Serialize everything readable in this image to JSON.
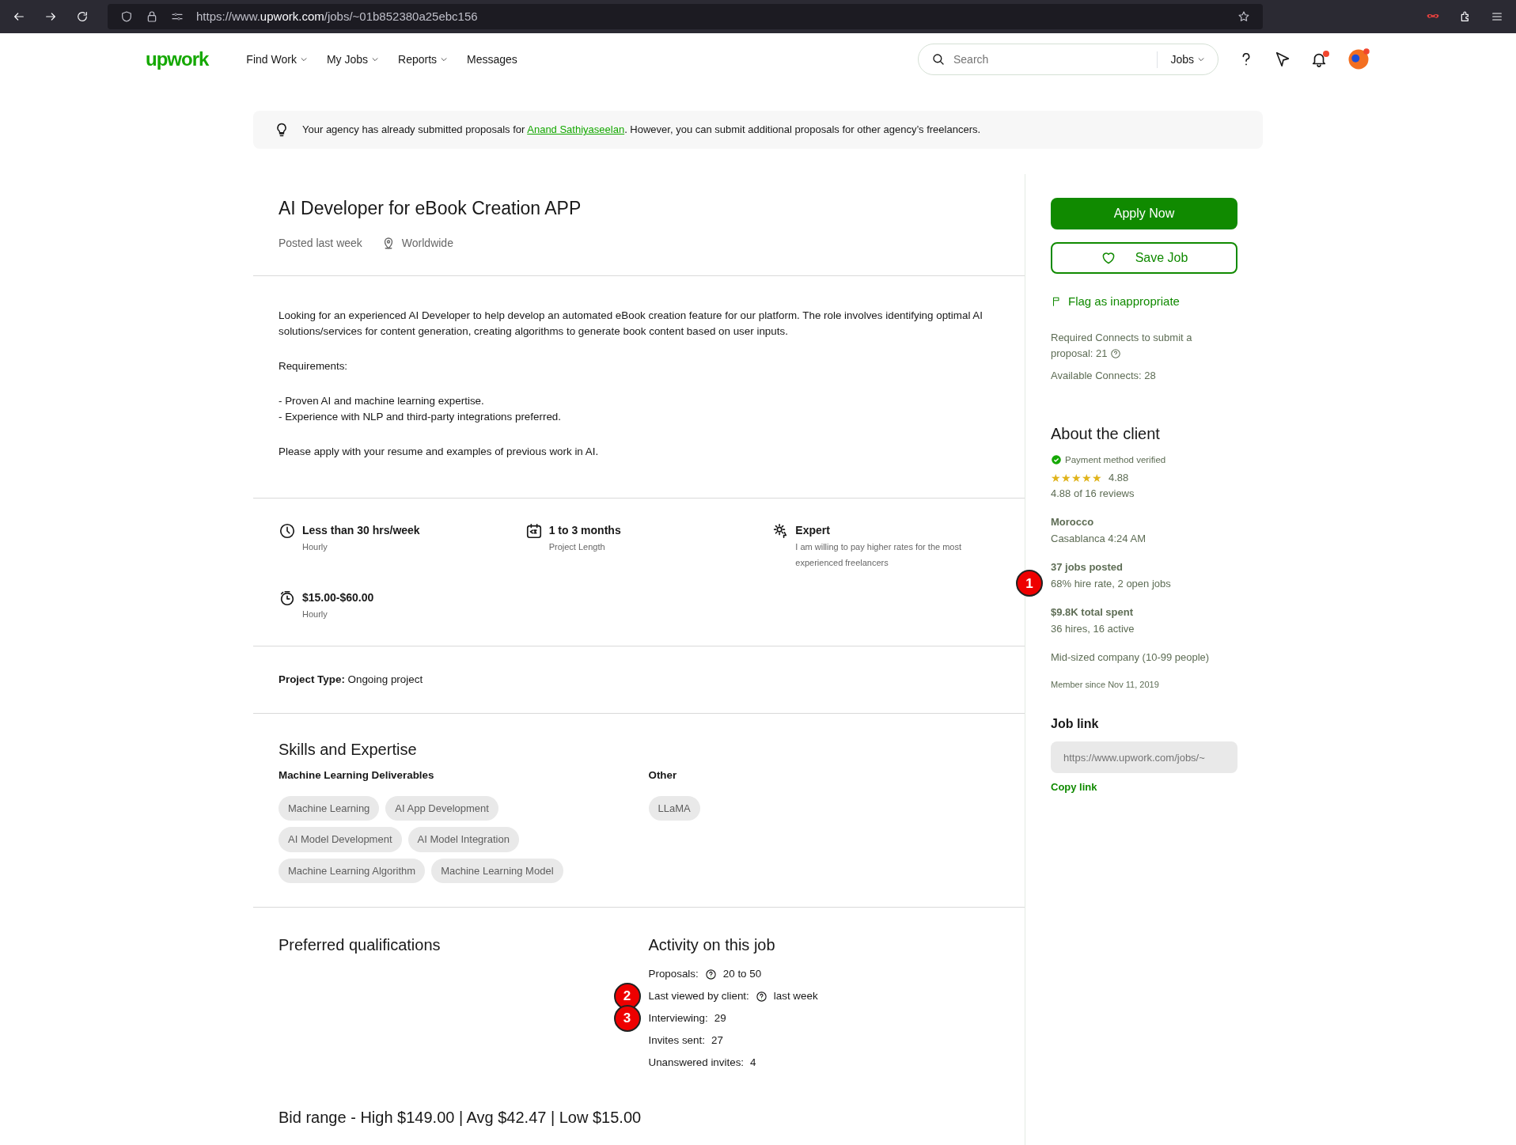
{
  "browser": {
    "url_prefix": "https://www.",
    "url_domain": "upwork.com",
    "url_path": "/jobs/~01b852380a25ebc156"
  },
  "nav": {
    "logo": "upwork",
    "menu": [
      {
        "label": "Find Work",
        "dropdown": true
      },
      {
        "label": "My Jobs",
        "dropdown": true
      },
      {
        "label": "Reports",
        "dropdown": true
      },
      {
        "label": "Messages",
        "dropdown": false
      }
    ],
    "search": {
      "placeholder": "Search",
      "scope": "Jobs"
    },
    "notification_dot": true
  },
  "notice": {
    "before": "Your agency has already submitted proposals for ",
    "link": "Anand Sathiyaseelan",
    "after": ". However, you can submit additional proposals for other agency’s freelancers."
  },
  "job": {
    "title": "AI Developer for eBook Creation APP",
    "posted": "Posted last week",
    "location": "Worldwide",
    "description": [
      "Looking for an experienced AI Developer to help develop an automated eBook creation feature for our platform. The role involves identifying optimal AI solutions/services for content generation, creating algorithms to generate book content based on user inputs.",
      "Requirements:",
      "- Proven AI and machine learning expertise.\n- Experience with NLP and third-party integrations preferred.",
      "Please apply with your resume and examples of previous work in AI."
    ],
    "features": [
      {
        "kind": "clock",
        "value": "Less than 30 hrs/week",
        "label": "Hourly"
      },
      {
        "kind": "calendar",
        "value": "1 to 3 months",
        "label": "Project Length"
      },
      {
        "kind": "expert",
        "value": "Expert",
        "label": "I am willing to pay higher rates for the most experienced freelancers"
      },
      {
        "kind": "timer",
        "value": "$15.00-$60.00",
        "label": "Hourly"
      }
    ],
    "project_type": {
      "label": "Project Type:",
      "value": "Ongoing project"
    },
    "skills": {
      "title": "Skills and Expertise",
      "groups": [
        {
          "name": "Machine Learning Deliverables",
          "tags": [
            "Machine Learning",
            "AI App Development",
            "AI Model Development",
            "AI Model Integration",
            "Machine Learning Algorithm",
            "Machine Learning Model"
          ]
        },
        {
          "name": "Other",
          "tags": [
            "LLaMA"
          ]
        }
      ]
    },
    "qualifications_title": "Preferred qualifications",
    "activity": {
      "title": "Activity on this job",
      "items": [
        {
          "label": "Proposals:",
          "help": true,
          "value": "20 to 50"
        },
        {
          "label": "Last viewed by client:",
          "help": true,
          "value": "last week",
          "annotation": "2"
        },
        {
          "label": "Interviewing:",
          "help": false,
          "value": "29",
          "annotation": "3"
        },
        {
          "label": "Invites sent:",
          "help": false,
          "value": "27"
        },
        {
          "label": "Unanswered invites:",
          "help": false,
          "value": "4"
        }
      ]
    },
    "bid_range": "Bid range - High $149.00 | Avg $42.47 | Low $15.00"
  },
  "sidebar": {
    "apply": "Apply Now",
    "save": "Save Job",
    "flag": "Flag as inappropriate",
    "connects_required": "Required Connects to submit a proposal: 21",
    "connects_available": "Available Connects: 28",
    "client": {
      "title": "About the client",
      "payment": "Payment method verified",
      "stars": 5,
      "rating": "4.88",
      "reviews": "4.88 of 16 reviews",
      "country": "Morocco",
      "city": "Casablanca 4:24 AM",
      "jobs_posted": "37 jobs posted",
      "hire_rate": "68% hire rate, 2 open jobs",
      "hire_rate_annotation": "1",
      "spent": "$9.8K total spent",
      "hires": "36 hires, 16 active",
      "company": "Mid-sized company (10-99 people)",
      "member_since": "Member since Nov 11, 2019"
    },
    "job_link": {
      "title": "Job link",
      "placeholder": "https://www.upwork.com/jobs/~",
      "copy": "Copy link"
    }
  }
}
